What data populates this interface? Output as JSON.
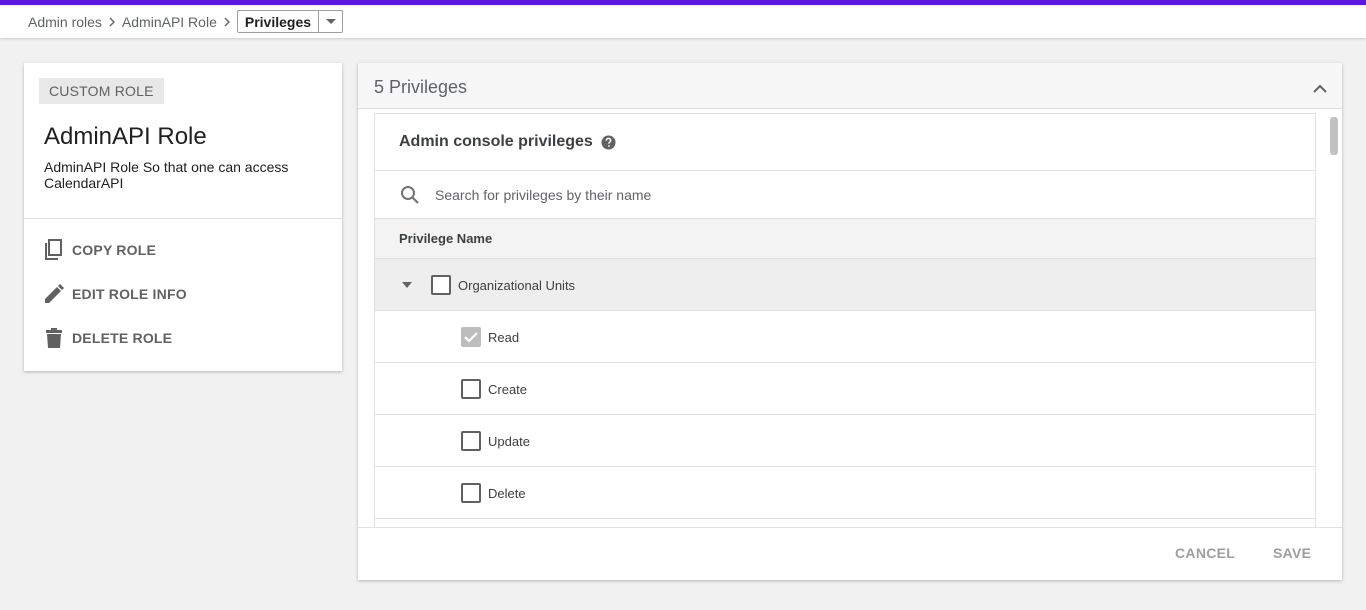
{
  "colors": {
    "accent": "#5c18e0"
  },
  "breadcrumb": {
    "items": [
      "Admin roles",
      "AdminAPI Role"
    ],
    "current": "Privileges"
  },
  "role": {
    "chip": "CUSTOM ROLE",
    "title": "AdminAPI Role",
    "description": "AdminAPI Role So that one can access CalendarAPI",
    "actions": [
      {
        "label": "COPY ROLE",
        "icon": "copy-icon"
      },
      {
        "label": "EDIT ROLE INFO",
        "icon": "pencil-icon"
      },
      {
        "label": "DELETE ROLE",
        "icon": "trash-icon"
      }
    ]
  },
  "privileges": {
    "header_title": "5 Privileges",
    "panel_title": "Admin console privileges",
    "search_placeholder": "Search for privileges by their name",
    "column_header": "Privilege Name",
    "group": {
      "label": "Organizational Units",
      "checked": false,
      "expanded": true
    },
    "items": [
      {
        "label": "Read",
        "checked": true,
        "disabled": true
      },
      {
        "label": "Create",
        "checked": false
      },
      {
        "label": "Update",
        "checked": false
      },
      {
        "label": "Delete",
        "checked": false
      }
    ]
  },
  "footer": {
    "cancel_label": "CANCEL",
    "save_label": "SAVE"
  }
}
